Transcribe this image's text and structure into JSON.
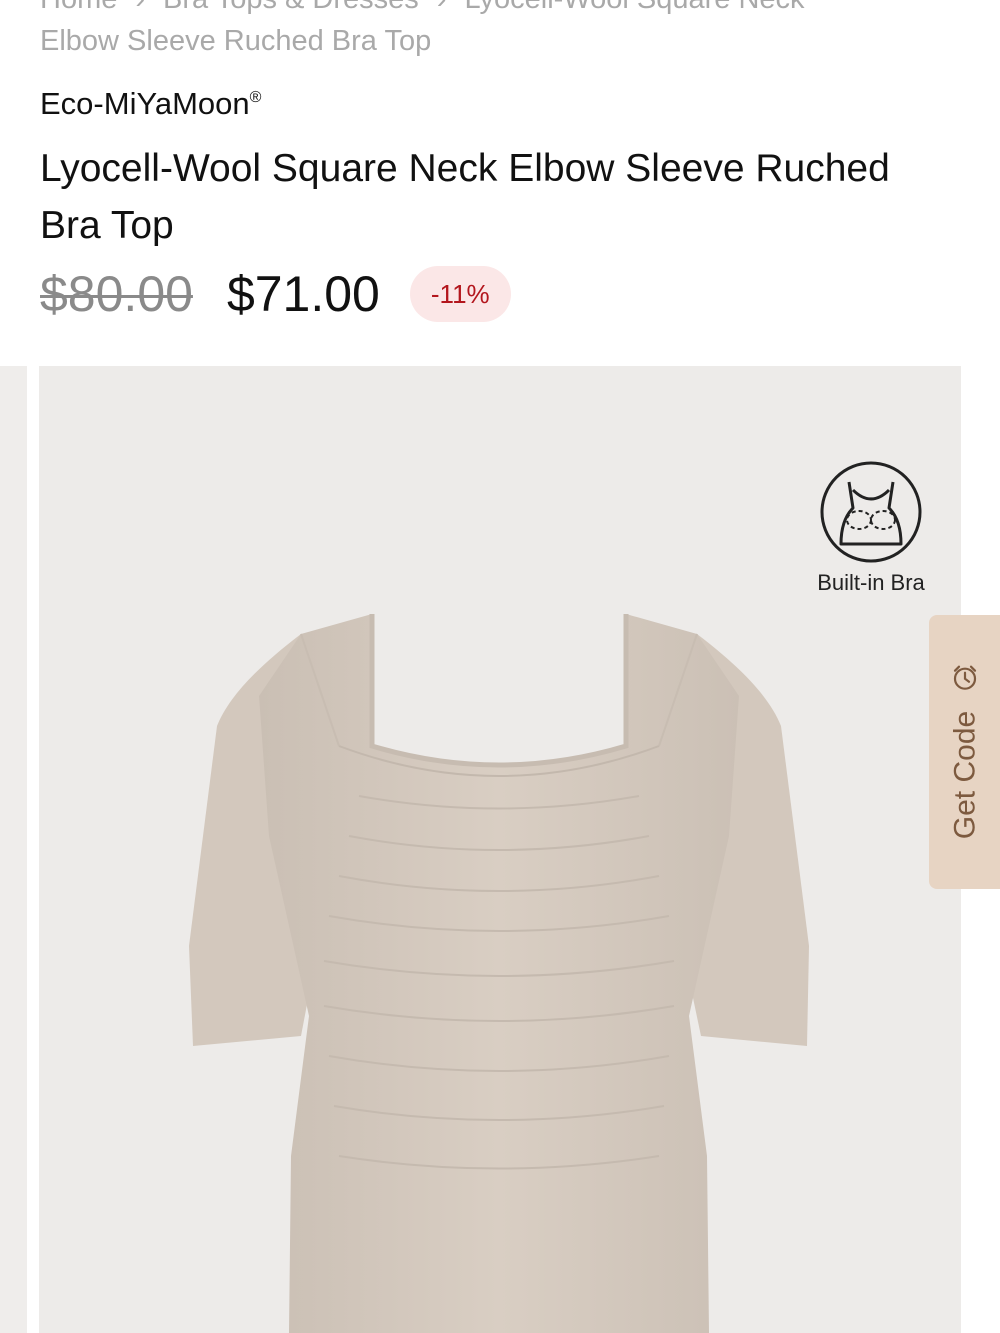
{
  "breadcrumb": {
    "items": [
      "Home",
      "Bra Tops & Dresses",
      "Lyocell-Wool Square Neck"
    ],
    "current_line2": "Elbow Sleeve Ruched Bra Top"
  },
  "product": {
    "brand": "Eco-MiYaMoon",
    "brand_mark": "®",
    "title": "Lyocell-Wool Square Neck Elbow Sleeve Ruched Bra Top",
    "original_price": "$80.00",
    "sale_price": "$71.00",
    "discount": "-11%"
  },
  "gallery": {
    "badge_label": "Built-in Bra",
    "badge_icon": "built-in-bra-icon"
  },
  "promo": {
    "get_code_label": "Get Code",
    "icon": "alarm-clock-icon"
  },
  "colors": {
    "discount_text": "#b3161d",
    "discount_bg": "#fbe7e7",
    "promo_bg": "#e7d4c3",
    "promo_text": "#7d5a3f",
    "garment": "#d6cbc0"
  }
}
